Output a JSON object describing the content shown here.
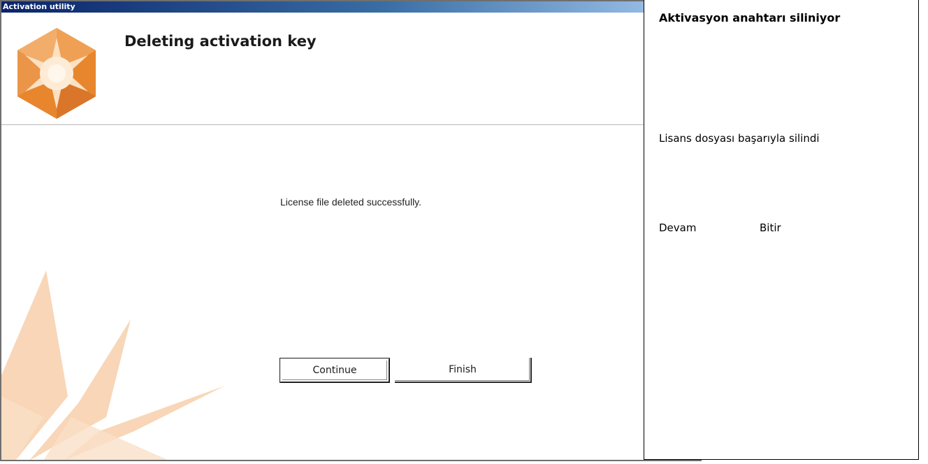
{
  "window": {
    "title": "Activation utility"
  },
  "header": {
    "title": "Deleting activation key",
    "logo_icon": "orange-star-hexagon-icon"
  },
  "content": {
    "message": "License file deleted successfully.",
    "background_icon": "faded-star-watermark-icon"
  },
  "buttons": {
    "continue_label": "Continue",
    "finish_label": "Finish"
  },
  "translation_panel": {
    "title": "Aktivasyon anahtarı siliniyor",
    "message": "Lisans dosyası başarıyla silindi",
    "continue_label": "Devam",
    "finish_label": "Bitir"
  },
  "colors": {
    "accent_orange": "#e8862d",
    "titlebar": "#0a246a"
  }
}
